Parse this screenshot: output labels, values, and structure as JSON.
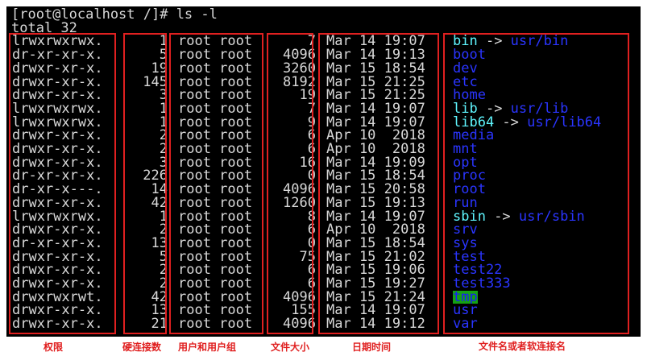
{
  "terminal": {
    "prompt_line": "[root@localhost /]# ls -l",
    "total_line": "total 32"
  },
  "colors": {
    "background": "#000000",
    "text": "#d9d9d9",
    "directory": "#2a35ff",
    "symlink": "#5ff6ff",
    "sticky_dir_bg": "#14a214",
    "annotation": "#e02020"
  },
  "entries": [
    {
      "perm": "lrwxrwxrwx.",
      "links": "1",
      "owner": "root root",
      "size": "7",
      "date": "Mar 14 19:07",
      "name": "bin",
      "kind": "link",
      "target": "usr/bin"
    },
    {
      "perm": "dr-xr-xr-x.",
      "links": "5",
      "owner": "root root",
      "size": "4096",
      "date": "Mar 14 19:13",
      "name": "boot",
      "kind": "dir",
      "target": ""
    },
    {
      "perm": "drwxr-xr-x.",
      "links": "19",
      "owner": "root root",
      "size": "3260",
      "date": "Mar 15 18:54",
      "name": "dev",
      "kind": "dir",
      "target": ""
    },
    {
      "perm": "drwxr-xr-x.",
      "links": "145",
      "owner": "root root",
      "size": "8192",
      "date": "Mar 15 21:25",
      "name": "etc",
      "kind": "dir",
      "target": ""
    },
    {
      "perm": "drwxr-xr-x.",
      "links": "3",
      "owner": "root root",
      "size": "19",
      "date": "Mar 15 21:25",
      "name": "home",
      "kind": "dir",
      "target": ""
    },
    {
      "perm": "lrwxrwxrwx.",
      "links": "1",
      "owner": "root root",
      "size": "7",
      "date": "Mar 14 19:07",
      "name": "lib",
      "kind": "link",
      "target": "usr/lib"
    },
    {
      "perm": "lrwxrwxrwx.",
      "links": "1",
      "owner": "root root",
      "size": "9",
      "date": "Mar 14 19:07",
      "name": "lib64",
      "kind": "link",
      "target": "usr/lib64"
    },
    {
      "perm": "drwxr-xr-x.",
      "links": "2",
      "owner": "root root",
      "size": "6",
      "date": "Apr 10  2018",
      "name": "media",
      "kind": "dir",
      "target": ""
    },
    {
      "perm": "drwxr-xr-x.",
      "links": "2",
      "owner": "root root",
      "size": "6",
      "date": "Apr 10  2018",
      "name": "mnt",
      "kind": "dir",
      "target": ""
    },
    {
      "perm": "drwxr-xr-x.",
      "links": "3",
      "owner": "root root",
      "size": "16",
      "date": "Mar 14 19:09",
      "name": "opt",
      "kind": "dir",
      "target": ""
    },
    {
      "perm": "dr-xr-xr-x.",
      "links": "226",
      "owner": "root root",
      "size": "0",
      "date": "Mar 15 18:54",
      "name": "proc",
      "kind": "dir",
      "target": ""
    },
    {
      "perm": "dr-xr-x---.",
      "links": "14",
      "owner": "root root",
      "size": "4096",
      "date": "Mar 15 20:58",
      "name": "root",
      "kind": "dir",
      "target": ""
    },
    {
      "perm": "drwxr-xr-x.",
      "links": "42",
      "owner": "root root",
      "size": "1260",
      "date": "Mar 15 19:13",
      "name": "run",
      "kind": "dir",
      "target": ""
    },
    {
      "perm": "lrwxrwxrwx.",
      "links": "1",
      "owner": "root root",
      "size": "8",
      "date": "Mar 14 19:07",
      "name": "sbin",
      "kind": "link",
      "target": "usr/sbin"
    },
    {
      "perm": "drwxr-xr-x.",
      "links": "2",
      "owner": "root root",
      "size": "6",
      "date": "Apr 10  2018",
      "name": "srv",
      "kind": "dir",
      "target": ""
    },
    {
      "perm": "dr-xr-xr-x.",
      "links": "13",
      "owner": "root root",
      "size": "0",
      "date": "Mar 15 18:54",
      "name": "sys",
      "kind": "dir",
      "target": ""
    },
    {
      "perm": "drwxr-xr-x.",
      "links": "5",
      "owner": "root root",
      "size": "75",
      "date": "Mar 15 21:02",
      "name": "test",
      "kind": "dir",
      "target": ""
    },
    {
      "perm": "drwxr-xr-x.",
      "links": "2",
      "owner": "root root",
      "size": "6",
      "date": "Mar 15 19:06",
      "name": "test22",
      "kind": "dir",
      "target": ""
    },
    {
      "perm": "drwxr-xr-x.",
      "links": "2",
      "owner": "root root",
      "size": "6",
      "date": "Mar 15 19:27",
      "name": "test333",
      "kind": "dir",
      "target": ""
    },
    {
      "perm": "drwxrwxrwt.",
      "links": "42",
      "owner": "root root",
      "size": "4096",
      "date": "Mar 15 21:24",
      "name": "tmp",
      "kind": "sticky",
      "target": ""
    },
    {
      "perm": "drwxr-xr-x.",
      "links": "13",
      "owner": "root root",
      "size": "155",
      "date": "Mar 14 19:07",
      "name": "usr",
      "kind": "dir",
      "target": ""
    },
    {
      "perm": "drwxr-xr-x.",
      "links": "21",
      "owner": "root root",
      "size": "4096",
      "date": "Mar 14 19:12",
      "name": "var",
      "kind": "dir",
      "target": ""
    }
  ],
  "annotations": {
    "permissions": "权限",
    "hard_links": "硬连接数",
    "user_group": "用户和用户组",
    "file_size": "文件大小",
    "datetime": "日期时间",
    "filename": "文件名或者软连接名"
  }
}
